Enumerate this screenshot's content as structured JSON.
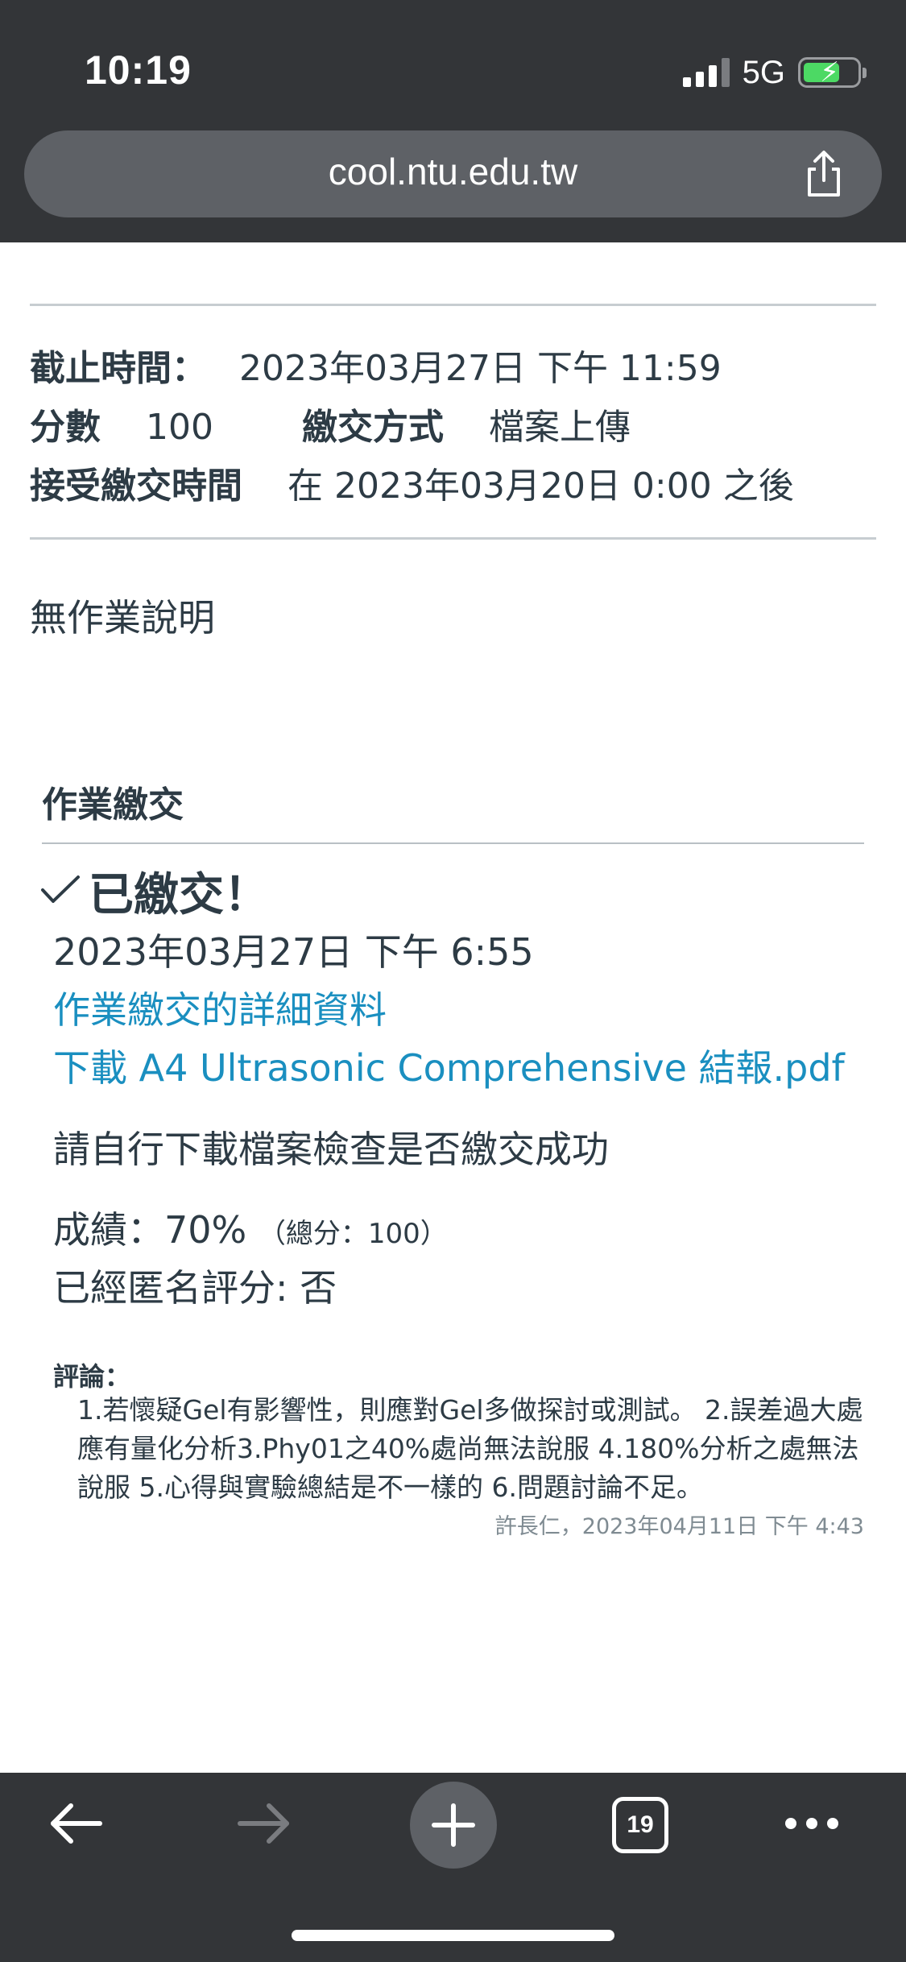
{
  "status_bar": {
    "time": "10:19",
    "network": "5G",
    "battery_level": 0.7,
    "battery_charging": true,
    "signal_bars": 3
  },
  "browser": {
    "url": "cool.ntu.edu.tw",
    "share_icon": "share-icon",
    "tab_count": "19"
  },
  "assignment": {
    "due_label": "截止時間：",
    "due_value": "2023年03月27日 下午 11:59",
    "points_label": "分數",
    "points_value": "100",
    "submission_type_label": "繳交方式",
    "submission_type_value": "檔案上傳",
    "available_label": "接受繳交時間",
    "available_value": "在 2023年03月20日 0:00 之後",
    "description": "無作業說明"
  },
  "submission": {
    "section_title": "作業繳交",
    "status": "已繳交！",
    "submitted_at": "2023年03月27日 下午 6:55",
    "details_link": "作業繳交的詳細資料",
    "download_link": "下載 A4 Ultrasonic Comprehensive 結報.pdf",
    "check_notice": "請自行下載檔案檢查是否繳交成功",
    "grade": "成績：70%",
    "grade_total": "（總分：100）",
    "anonymous": "已經匿名評分: 否"
  },
  "comments": {
    "label": "評論：",
    "body": "1.若懷疑Gel有影響性，則應對Gel多做探討或測試。 2.誤差過大處應有量化分析3.Phy01之40%處尚無法說服 4.180%分析之處無法說服 5.心得與實驗總結是不一樣的 6.問題討論不足。",
    "author_line": "許長仁，2023年04月11日 下午 4:43"
  },
  "colors": {
    "chrome": "#333538",
    "url_bar": "#5e6166",
    "link": "#1a8fc0",
    "text": "#2d3b45",
    "rule": "#c7cdd1"
  }
}
